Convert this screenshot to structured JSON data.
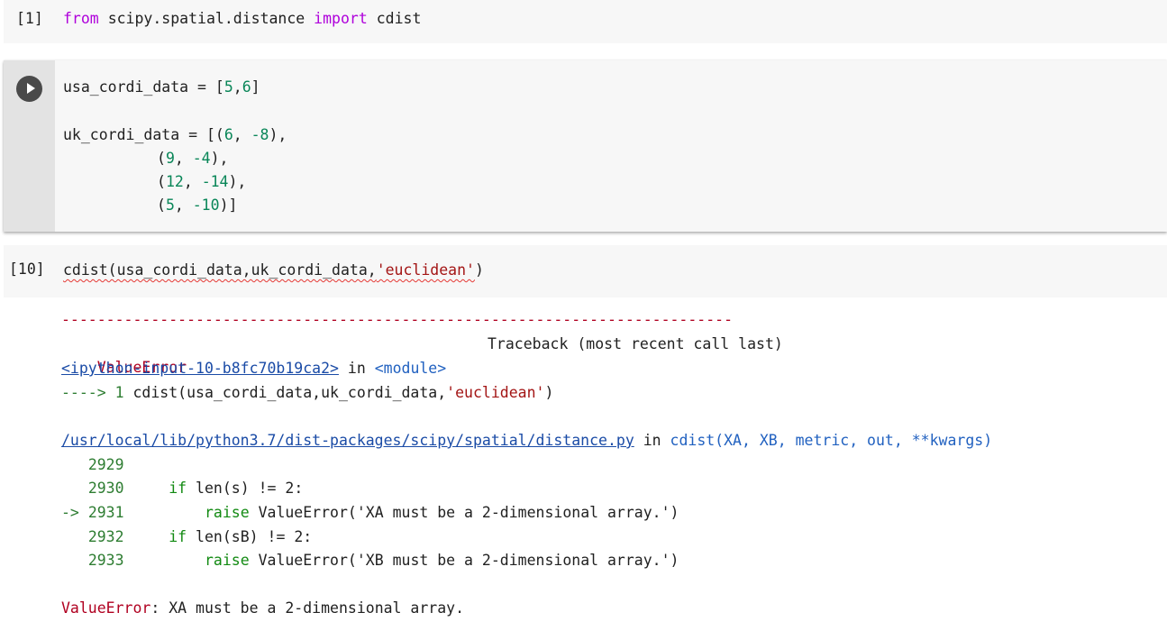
{
  "cells": [
    {
      "prompt": "[1]",
      "code": {
        "kw_from": "from",
        "module": "scipy.spatial.distance",
        "kw_import": "import",
        "name": "cdist"
      }
    },
    {
      "line1": {
        "var": "usa_cordi_data",
        "eq": " = [",
        "n1": "5",
        "comma": ",",
        "n2": "6",
        "close": "]"
      },
      "line2": {
        "var": "uk_cordi_data",
        "eq": " = [(",
        "n1": "6",
        "sep": ", ",
        "n2": "-8",
        "close": "),"
      },
      "line3": {
        "open": "(",
        "n1": "9",
        "sep": ", ",
        "n2": "-4",
        "close": "),"
      },
      "line4": {
        "open": "(",
        "n1": "12",
        "sep": ", ",
        "n2": "-14",
        "close": "),"
      },
      "line5": {
        "open": "(",
        "n1": "5",
        "sep": ", ",
        "n2": "-10",
        "close": ")]"
      }
    },
    {
      "prompt": "[10]",
      "code": {
        "call": "cdist(usa_cordi_data,uk_cordi_data,",
        "arg": "'euclidean'",
        "close": ")"
      }
    }
  ],
  "output": {
    "dashes": "---------------------------------------------------------------------------",
    "error_name": "ValueError",
    "traceback_label": "Traceback (most recent call last)",
    "input_link": "<ipython-input-10-b8fc70b19ca2>",
    "in_word": " in ",
    "module_word": "<module>",
    "arrow_line": {
      "arrow": "----> 1 ",
      "call": "cdist(usa_cordi_data,uk_cordi_data,",
      "arg": "'euclidean'",
      "close": ")"
    },
    "file_link": "/usr/local/lib/python3.7/dist-packages/scipy/spatial/distance.py",
    "file_in": " in ",
    "func_sig": "cdist(XA, XB, metric, out, **kwargs)",
    "source_lines": [
      {
        "marker": "   ",
        "num": "2929",
        "kw": "",
        "rest": ""
      },
      {
        "marker": "   ",
        "num": "2930",
        "kw": "if",
        "rest": " len(s) != 2:"
      },
      {
        "marker": "-> ",
        "num": "2931",
        "kw": "raise",
        "rest": " ValueError('XA must be a 2-dimensional array.')"
      },
      {
        "marker": "   ",
        "num": "2932",
        "kw": "if",
        "rest": " len(sB) != 2:"
      },
      {
        "marker": "   ",
        "num": "2933",
        "kw": "raise",
        "rest": " ValueError('XB must be a 2-dimensional array.')"
      }
    ],
    "final_error_name": "ValueError",
    "final_error_msg": ": XA must be a 2-dimensional array."
  }
}
